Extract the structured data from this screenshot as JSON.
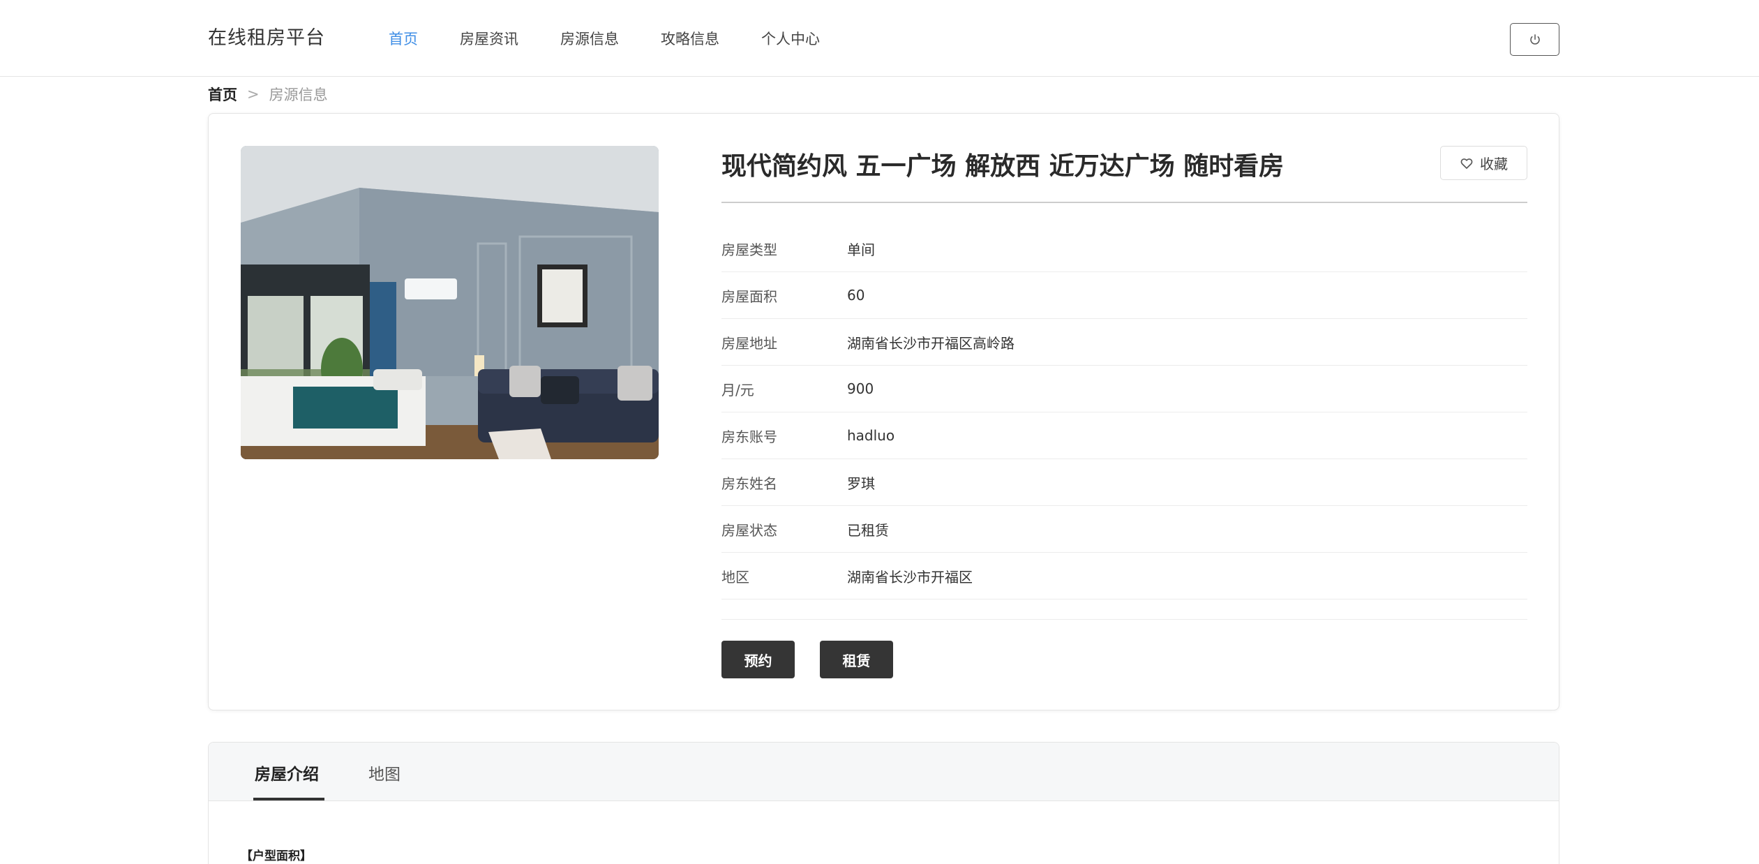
{
  "header": {
    "brand": "在线租房平台",
    "nav": [
      {
        "label": "首页",
        "active": true
      },
      {
        "label": "房屋资讯",
        "active": false
      },
      {
        "label": "房源信息",
        "active": false
      },
      {
        "label": "攻略信息",
        "active": false
      },
      {
        "label": "个人中心",
        "active": false
      }
    ],
    "power_icon": "power-icon",
    "accent_color": "#3f8ee6"
  },
  "breadcrumb": {
    "home": "首页",
    "separator": ">",
    "current": "房源信息"
  },
  "detail": {
    "title": "现代简约风 五一广场 解放西 近万达广场 随时看房",
    "favorite_label": "收藏",
    "favorite_icon": "heart-outline-icon",
    "fields": [
      {
        "label": "房屋类型",
        "value": "单间"
      },
      {
        "label": "房屋面积",
        "value": "60"
      },
      {
        "label": "房屋地址",
        "value": "湖南省长沙市开福区高岭路"
      },
      {
        "label": "月/元",
        "value": "900"
      },
      {
        "label": "房东账号",
        "value": "hadluo"
      },
      {
        "label": "房东姓名",
        "value": "罗琪"
      },
      {
        "label": "房屋状态",
        "value": "已租赁"
      },
      {
        "label": "地区",
        "value": "湖南省长沙市开福区"
      }
    ],
    "actions": {
      "reserve": "预约",
      "rent": "租赁"
    }
  },
  "tabs": {
    "items": [
      {
        "label": "房屋介绍",
        "active": true
      },
      {
        "label": "地图",
        "active": false
      }
    ],
    "section_label": "【户型面积】"
  }
}
